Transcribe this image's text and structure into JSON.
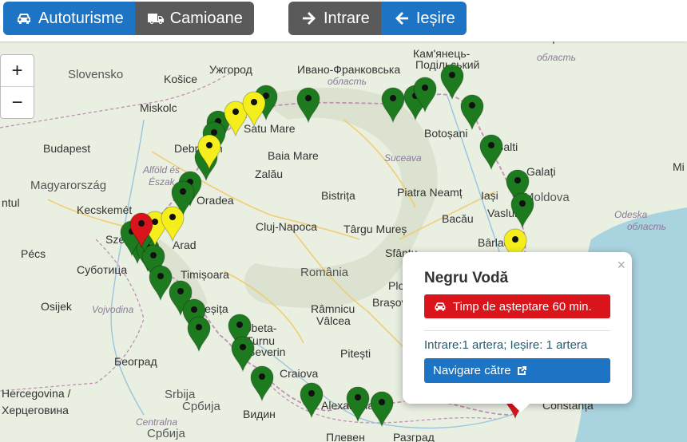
{
  "toolbar": {
    "vehicle_cars": "Autoturisme",
    "vehicle_trucks": "Camioane",
    "direction_in": "Intrare",
    "direction_out": "Ieșire"
  },
  "zoom": {
    "in": "+",
    "out": "−"
  },
  "colors": {
    "green": "#1e7a1e",
    "yellow": "#f4ef1c",
    "red": "#d9141b",
    "blue": "#1e74c4"
  },
  "map_labels": [
    "Slovensko",
    "Košice",
    "Ужгород",
    "Ивано-Франковська",
    "область",
    "Кам'янець-",
    "Подільський",
    "Вінницька",
    "область",
    "Miskolc",
    "Satu Mare",
    "Baia Mare",
    "Botoșani",
    "Suceava",
    "Budapest",
    "Debrecen",
    "Zalău",
    "Bistrița",
    "Piatra Neamț",
    "Iași",
    "Moldova",
    "Magyarország",
    "Alföld és",
    "Észak",
    "Oradea",
    "Cluj-Napoca",
    "Târgu Mureș",
    "Bacău",
    "Vaslui",
    "Odeska",
    "область",
    "Kecskemét",
    "Szeged",
    "Arad",
    "Bârlad",
    "Pécs",
    "Субoтица",
    "Timișoara",
    "România",
    "Sfântu",
    "Osijek",
    "Vojvodina",
    "Reșița",
    "Râmnicu",
    "Vâlcea",
    "Brașov",
    "Drobeta-",
    "Turnu",
    "Severin",
    "Pitești",
    "Београд",
    "Craiova",
    "Srbija",
    "Србија",
    "Видин",
    "Alexandria",
    "Constanța",
    "Hercegovina /",
    "Херцеговина",
    "Centralna",
    "Србија",
    "Плевен",
    "Разград",
    "Balti",
    "Galați",
    "Mi",
    "ntul",
    "Ploie"
  ],
  "markers": [
    {
      "status": "green"
    },
    {
      "status": "green"
    },
    {
      "status": "green"
    },
    {
      "status": "green"
    },
    {
      "status": "green"
    },
    {
      "status": "green"
    },
    {
      "status": "green"
    },
    {
      "status": "green"
    },
    {
      "status": "green"
    },
    {
      "status": "green"
    },
    {
      "status": "green"
    },
    {
      "status": "green"
    },
    {
      "status": "green"
    },
    {
      "status": "green"
    },
    {
      "status": "green"
    },
    {
      "status": "green"
    },
    {
      "status": "green"
    },
    {
      "status": "green"
    },
    {
      "status": "green"
    },
    {
      "status": "green"
    },
    {
      "status": "green"
    },
    {
      "status": "green"
    },
    {
      "status": "green"
    },
    {
      "status": "green"
    },
    {
      "status": "green"
    },
    {
      "status": "green"
    },
    {
      "status": "green"
    },
    {
      "status": "green"
    },
    {
      "status": "green"
    },
    {
      "status": "green"
    },
    {
      "status": "yellow"
    },
    {
      "status": "yellow"
    },
    {
      "status": "yellow"
    },
    {
      "status": "yellow"
    },
    {
      "status": "yellow"
    },
    {
      "status": "yellow"
    },
    {
      "status": "red"
    },
    {
      "status": "red"
    }
  ],
  "popup": {
    "close": "×",
    "title": "Negru Vodă",
    "wait": "Timp de așteptare 60 min.",
    "info": "Intrare:1 artera; Ieșire: 1 artera",
    "navigate": "Navigare către"
  }
}
